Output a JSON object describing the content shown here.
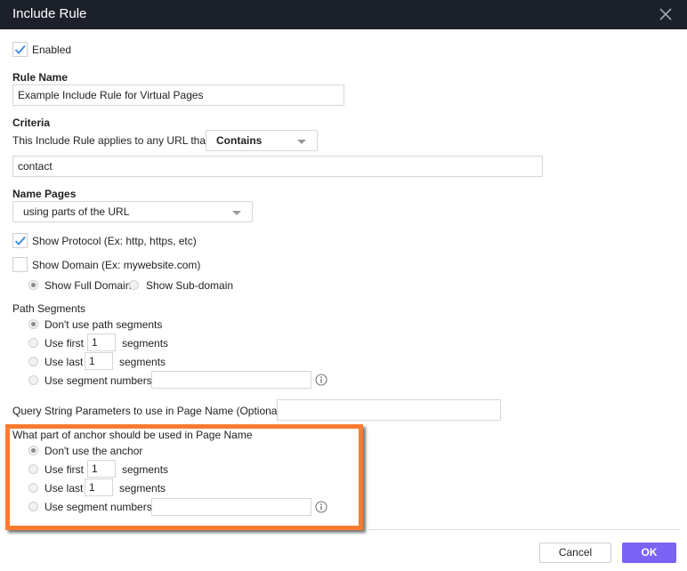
{
  "dialog": {
    "title": "Include Rule",
    "close_icon": "close-icon"
  },
  "enabled": {
    "label": "Enabled",
    "checked": true
  },
  "rule_name": {
    "label": "Rule Name",
    "value": "Example Include Rule for Virtual Pages"
  },
  "criteria": {
    "label": "Criteria",
    "applies_text": "This Include Rule applies to any URL that",
    "match_type": "Contains",
    "value": "contact"
  },
  "name_pages": {
    "label": "Name Pages",
    "selected": "using parts of the URL"
  },
  "show_protocol": {
    "label": "Show Protocol (Ex: http, https, etc)",
    "checked": true
  },
  "show_domain": {
    "label": "Show Domain (Ex: mywebsite.com)",
    "checked": false,
    "options": [
      {
        "label": "Show Full Domain",
        "selected": true
      },
      {
        "label": "Show Sub-domain",
        "selected": false
      }
    ]
  },
  "path_segments": {
    "label": "Path Segments",
    "options": {
      "none": {
        "label": "Don't use path segments",
        "selected": true
      },
      "first": {
        "label": "Use first",
        "value": "1",
        "suffix": "segments",
        "selected": false
      },
      "last": {
        "label": "Use last",
        "value": "1",
        "suffix": "segments",
        "selected": false
      },
      "numbers": {
        "label": "Use segment numbers",
        "value": "",
        "selected": false
      }
    }
  },
  "query_string": {
    "label": "Query String Parameters to use in Page Name (Optional)",
    "value": ""
  },
  "anchor": {
    "label": "What part of anchor should be used in Page Name",
    "options": {
      "none": {
        "label": "Don't use the anchor",
        "selected": true
      },
      "first": {
        "label": "Use first",
        "value": "1",
        "suffix": "segments",
        "selected": false
      },
      "last": {
        "label": "Use last",
        "value": "1",
        "suffix": "segments",
        "selected": false
      },
      "numbers": {
        "label": "Use segment numbers",
        "value": "",
        "selected": false
      }
    }
  },
  "highlight_color": "#fb7c2d",
  "footer": {
    "cancel_label": "Cancel",
    "ok_label": "OK",
    "ok_color": "#7b63f6"
  }
}
